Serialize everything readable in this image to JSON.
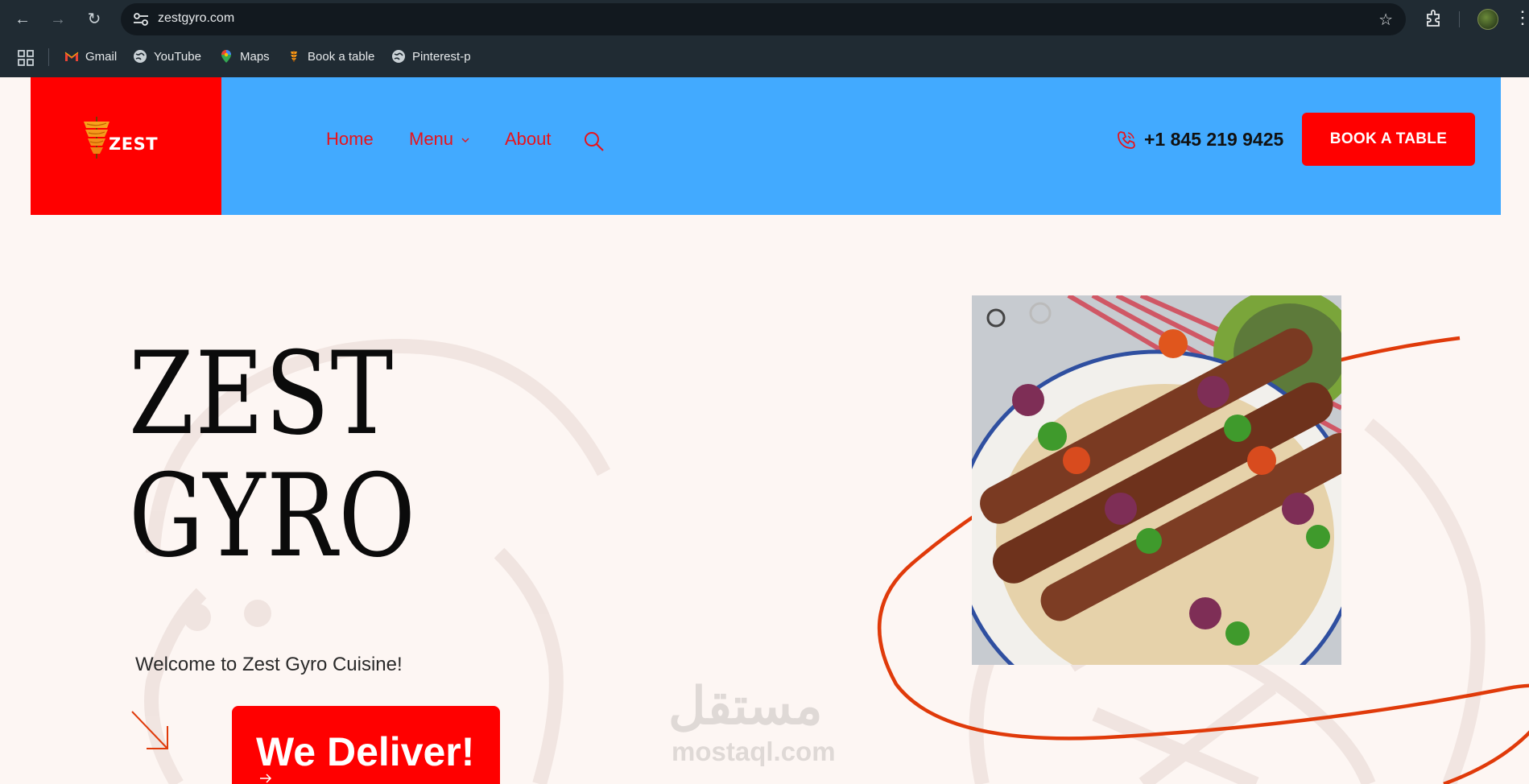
{
  "browser": {
    "url": "zestgyro.com",
    "bookmarks": [
      {
        "label": "Gmail",
        "icon": "gmail-icon"
      },
      {
        "label": "YouTube",
        "icon": "globe-icon"
      },
      {
        "label": "Maps",
        "icon": "maps-icon"
      },
      {
        "label": "Book a table",
        "icon": "zest-icon"
      },
      {
        "label": "Pinterest-p",
        "icon": "globe-icon"
      }
    ]
  },
  "site": {
    "logo_text": "ZEST",
    "nav": [
      "Home",
      "Menu",
      "About"
    ],
    "phone": "+1 845 219 9425",
    "book_button": "BOOK A TABLE",
    "accent_color": "#ff0000",
    "header_color": "#42aaff"
  },
  "hero": {
    "title_line1": "ZEST",
    "title_line2": "GYRO",
    "welcome": "Welcome to Zest Gyro Cuisine!",
    "deliver_button": "We Deliver!"
  },
  "watermark": {
    "arabic": "مستقل",
    "latin": "mostaql.com"
  }
}
